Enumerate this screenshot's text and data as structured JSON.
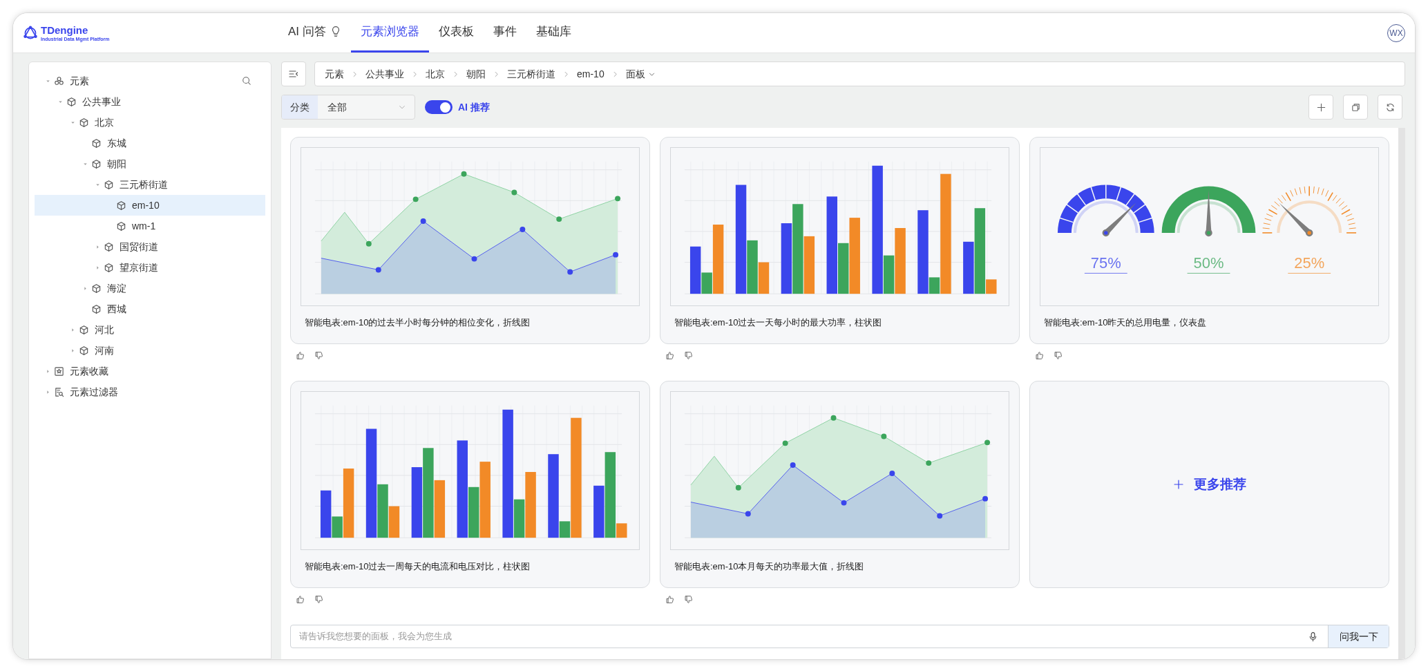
{
  "header": {
    "logo": {
      "name": "TDengine",
      "tagline": "Industrial Data Mgmt Platform"
    },
    "tabs": [
      {
        "label": "AI 问答",
        "kind": "ai",
        "selected": false
      },
      {
        "label": "元素浏览器",
        "kind": "plain",
        "selected": true
      },
      {
        "label": "仪表板",
        "kind": "plain",
        "selected": false
      },
      {
        "label": "事件",
        "kind": "plain",
        "selected": false
      },
      {
        "label": "基础库",
        "kind": "plain",
        "selected": false
      }
    ],
    "avatar": "WX"
  },
  "sidebar": {
    "tree": [
      {
        "label": "元素",
        "kind": "root",
        "expanded": true,
        "selected": false,
        "children": [
          {
            "label": "公共事业",
            "kind": "node",
            "expanded": true,
            "selected": false,
            "children": [
              {
                "label": "北京",
                "kind": "node",
                "expanded": true,
                "selected": false,
                "children": [
                  {
                    "label": "东城",
                    "kind": "node",
                    "selected": false
                  },
                  {
                    "label": "朝阳",
                    "kind": "node",
                    "expanded": true,
                    "selected": false,
                    "children": [
                      {
                        "label": "三元桥街道",
                        "kind": "node",
                        "expanded": true,
                        "selected": false,
                        "children": [
                          {
                            "label": "em-10",
                            "kind": "node",
                            "selected": true
                          },
                          {
                            "label": "wm-1",
                            "kind": "node",
                            "selected": false
                          }
                        ]
                      },
                      {
                        "label": "国贸街道",
                        "kind": "node",
                        "expanded": false,
                        "selected": false
                      },
                      {
                        "label": "望京街道",
                        "kind": "node",
                        "expanded": false,
                        "selected": false
                      }
                    ]
                  },
                  {
                    "label": "海淀",
                    "kind": "node",
                    "expanded": false,
                    "selected": false
                  },
                  {
                    "label": "西城",
                    "kind": "node",
                    "selected": false
                  }
                ]
              },
              {
                "label": "河北",
                "kind": "node",
                "expanded": false,
                "selected": false
              },
              {
                "label": "河南",
                "kind": "node",
                "expanded": false,
                "selected": false
              }
            ]
          }
        ]
      },
      {
        "label": "元素收藏",
        "kind": "favorites",
        "expanded": false,
        "selected": false
      },
      {
        "label": "元素过滤器",
        "kind": "filter",
        "expanded": false,
        "selected": false
      }
    ]
  },
  "breadcrumb": {
    "items": [
      "元素",
      "公共事业",
      "北京",
      "朝阳",
      "三元桥街道",
      "em-10"
    ],
    "current": "面板"
  },
  "filter": {
    "label": "分类",
    "value": "全部"
  },
  "ai_toggle": {
    "label": "AI 推荐",
    "on": true
  },
  "cards": [
    {
      "kind": "line",
      "caption": "智能电表:em-10的过去半小时每分钟的相位变化，折线图"
    },
    {
      "kind": "bar",
      "caption": "智能电表:em-10过去一天每小时的最大功率，柱状图"
    },
    {
      "kind": "gauge",
      "caption": "智能电表:em-10昨天的总用电量，仪表盘",
      "gauges": [
        {
          "kind": "segmented",
          "reading": "75%",
          "color": "#3a45ec"
        },
        {
          "kind": "solid",
          "reading": "50%",
          "color": "#3ca55c"
        },
        {
          "kind": "ticks",
          "reading": "25%",
          "color": "#f28a27"
        }
      ]
    },
    {
      "kind": "bar",
      "caption": "智能电表:em-10过去一周每天的电流和电压对比，柱状图"
    },
    {
      "kind": "line",
      "caption": "智能电表:em-10本月每天的功率最大值，折线图"
    }
  ],
  "more_card": {
    "label": "更多推荐"
  },
  "prompt": {
    "placeholder": "请告诉我您想要的面板，我会为您生成",
    "button": "问我一下"
  }
}
